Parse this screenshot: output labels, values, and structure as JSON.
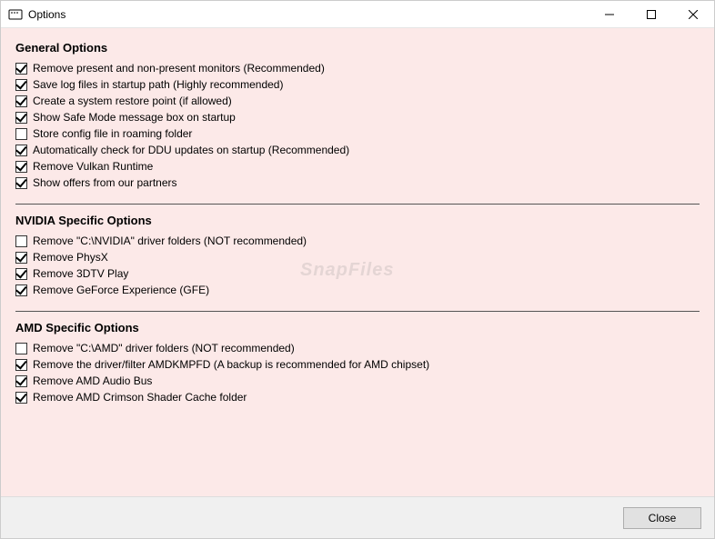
{
  "window": {
    "title": "Options"
  },
  "sections": [
    {
      "title": "General Options",
      "options": [
        {
          "label": "Remove present and non-present monitors (Recommended)",
          "checked": true
        },
        {
          "label": "Save log files in startup path (Highly recommended)",
          "checked": true
        },
        {
          "label": "Create a system restore point (if allowed)",
          "checked": true
        },
        {
          "label": "Show Safe Mode message box on startup",
          "checked": true
        },
        {
          "label": "Store config file in roaming folder",
          "checked": false
        },
        {
          "label": "Automatically check for DDU updates on startup (Recommended)",
          "checked": true
        },
        {
          "label": "Remove Vulkan Runtime",
          "checked": true
        },
        {
          "label": "Show offers from our partners",
          "checked": true
        }
      ]
    },
    {
      "title": "NVIDIA Specific Options",
      "options": [
        {
          "label": "Remove \"C:\\NVIDIA\" driver folders (NOT recommended)",
          "checked": false
        },
        {
          "label": "Remove PhysX",
          "checked": true
        },
        {
          "label": "Remove 3DTV Play",
          "checked": true
        },
        {
          "label": "Remove GeForce Experience (GFE)",
          "checked": true
        }
      ]
    },
    {
      "title": "AMD Specific Options",
      "options": [
        {
          "label": "Remove \"C:\\AMD\" driver folders (NOT recommended)",
          "checked": false
        },
        {
          "label": "Remove the driver/filter AMDKMPFD (A backup is recommended for AMD chipset)",
          "checked": true
        },
        {
          "label": "Remove AMD Audio Bus",
          "checked": true
        },
        {
          "label": "Remove AMD Crimson Shader Cache folder",
          "checked": true
        }
      ]
    }
  ],
  "footer": {
    "close_label": "Close"
  },
  "watermark": "SnapFiles"
}
